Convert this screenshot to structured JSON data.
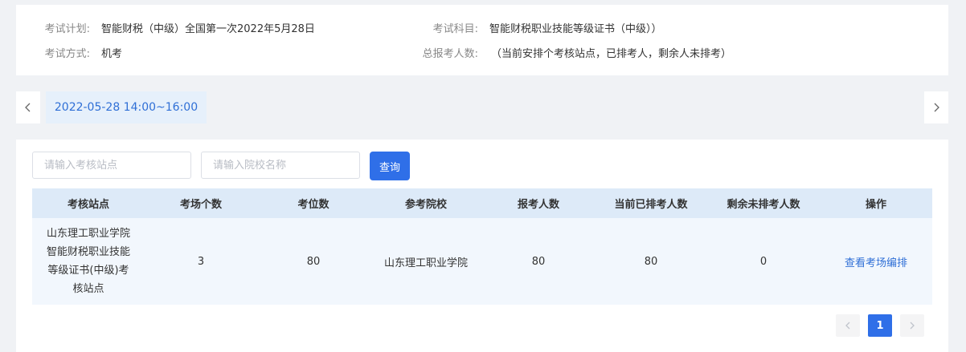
{
  "exam_info": {
    "plan_label": "考试计划:",
    "plan_value": "智能财税（中级）全国第一次2022年5月28日",
    "subject_label": "考试科目:",
    "subject_value": "智能财税职业技能等级证书（中级））",
    "method_label": "考试方式:",
    "method_value": "机考",
    "total_label": "总报考人数:",
    "total_value": "（当前安排个考核站点，已排考人，剩余人未排考）"
  },
  "schedule": {
    "date_tab": "2022-05-28 14:00~16:00",
    "prev_icon": "chevron-left-icon",
    "next_icon": "chevron-right-icon"
  },
  "filters": {
    "site_placeholder": "请输入考核站点",
    "school_placeholder": "请输入院校名称",
    "query_label": "查询"
  },
  "table": {
    "headers": [
      "考核站点",
      "考场个数",
      "考位数",
      "参考院校",
      "报考人数",
      "当前已排考人数",
      "剩余未排考人数",
      "操作"
    ],
    "rows": [
      {
        "site_line1": "山东理工职业学院",
        "site_line2": "智能财税职业技能",
        "site_line3": "等级证书(中级)考",
        "site_line4": "核站点",
        "rooms": "3",
        "seats": "80",
        "school": "山东理工职业学院",
        "applicants": "80",
        "scheduled": "80",
        "remaining": "0",
        "action": "查看考场编排"
      }
    ]
  },
  "pagination": {
    "current_page": "1"
  },
  "colors": {
    "accent": "#2f6fe8",
    "link": "#2f6fd6",
    "header_bg": "#ddeaf8",
    "row_bg": "#f2f7fd"
  }
}
